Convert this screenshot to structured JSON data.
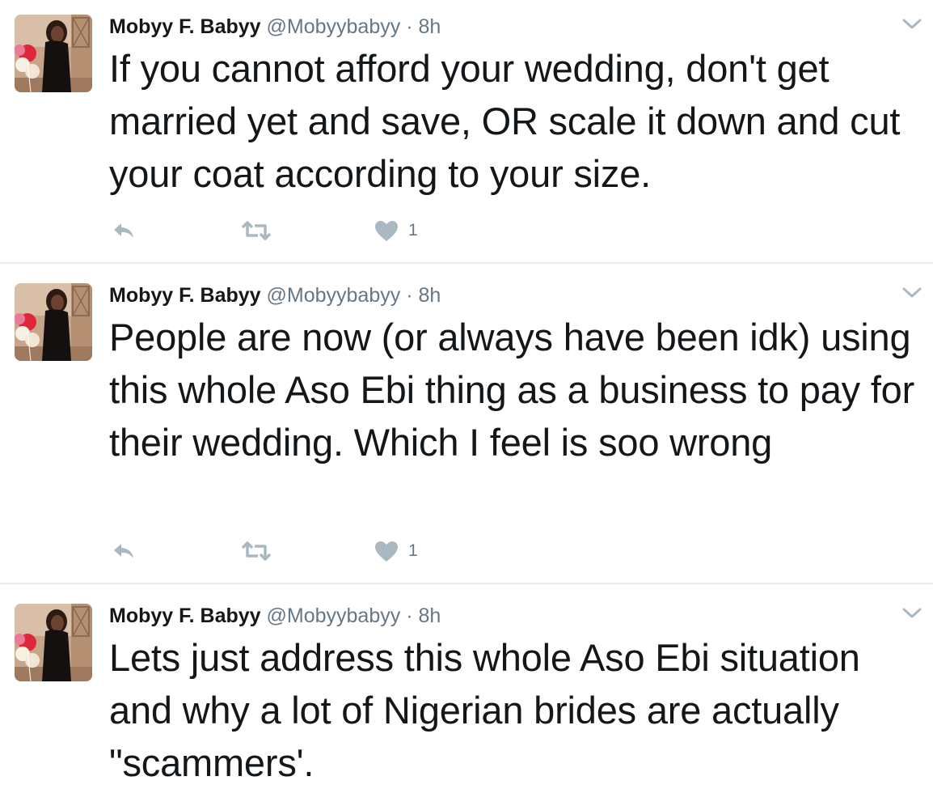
{
  "tweets": [
    {
      "fullname": "Mobyy F. Babyy",
      "username": "@Mobyybabyy",
      "separator": "·",
      "time": "8h",
      "text": "If you cannot afford your wedding, don't get married yet and save, OR scale it down and cut your coat according to your size.",
      "like_count": "1"
    },
    {
      "fullname": "Mobyy F. Babyy",
      "username": "@Mobyybabyy",
      "separator": "·",
      "time": "8h",
      "text": "People are now (or always have been idk) using this whole Aso Ebi thing as a business to pay for their wedding. Which I feel is soo wrong",
      "like_count": "1"
    },
    {
      "fullname": "Mobyy F. Babyy",
      "username": "@Mobyybabyy",
      "separator": "·",
      "time": "8h",
      "text": "Lets just address this whole Aso Ebi situation and why a lot of Nigerian brides are actually \"scammers'."
    }
  ],
  "icons": {
    "reply": "reply-icon",
    "retweet": "retweet-icon",
    "like": "heart-icon",
    "more": "chevron-down-icon"
  },
  "colors": {
    "text": "#14171a",
    "secondary": "#657786",
    "icon": "#aab8c2",
    "divider": "#e6ecf0"
  }
}
